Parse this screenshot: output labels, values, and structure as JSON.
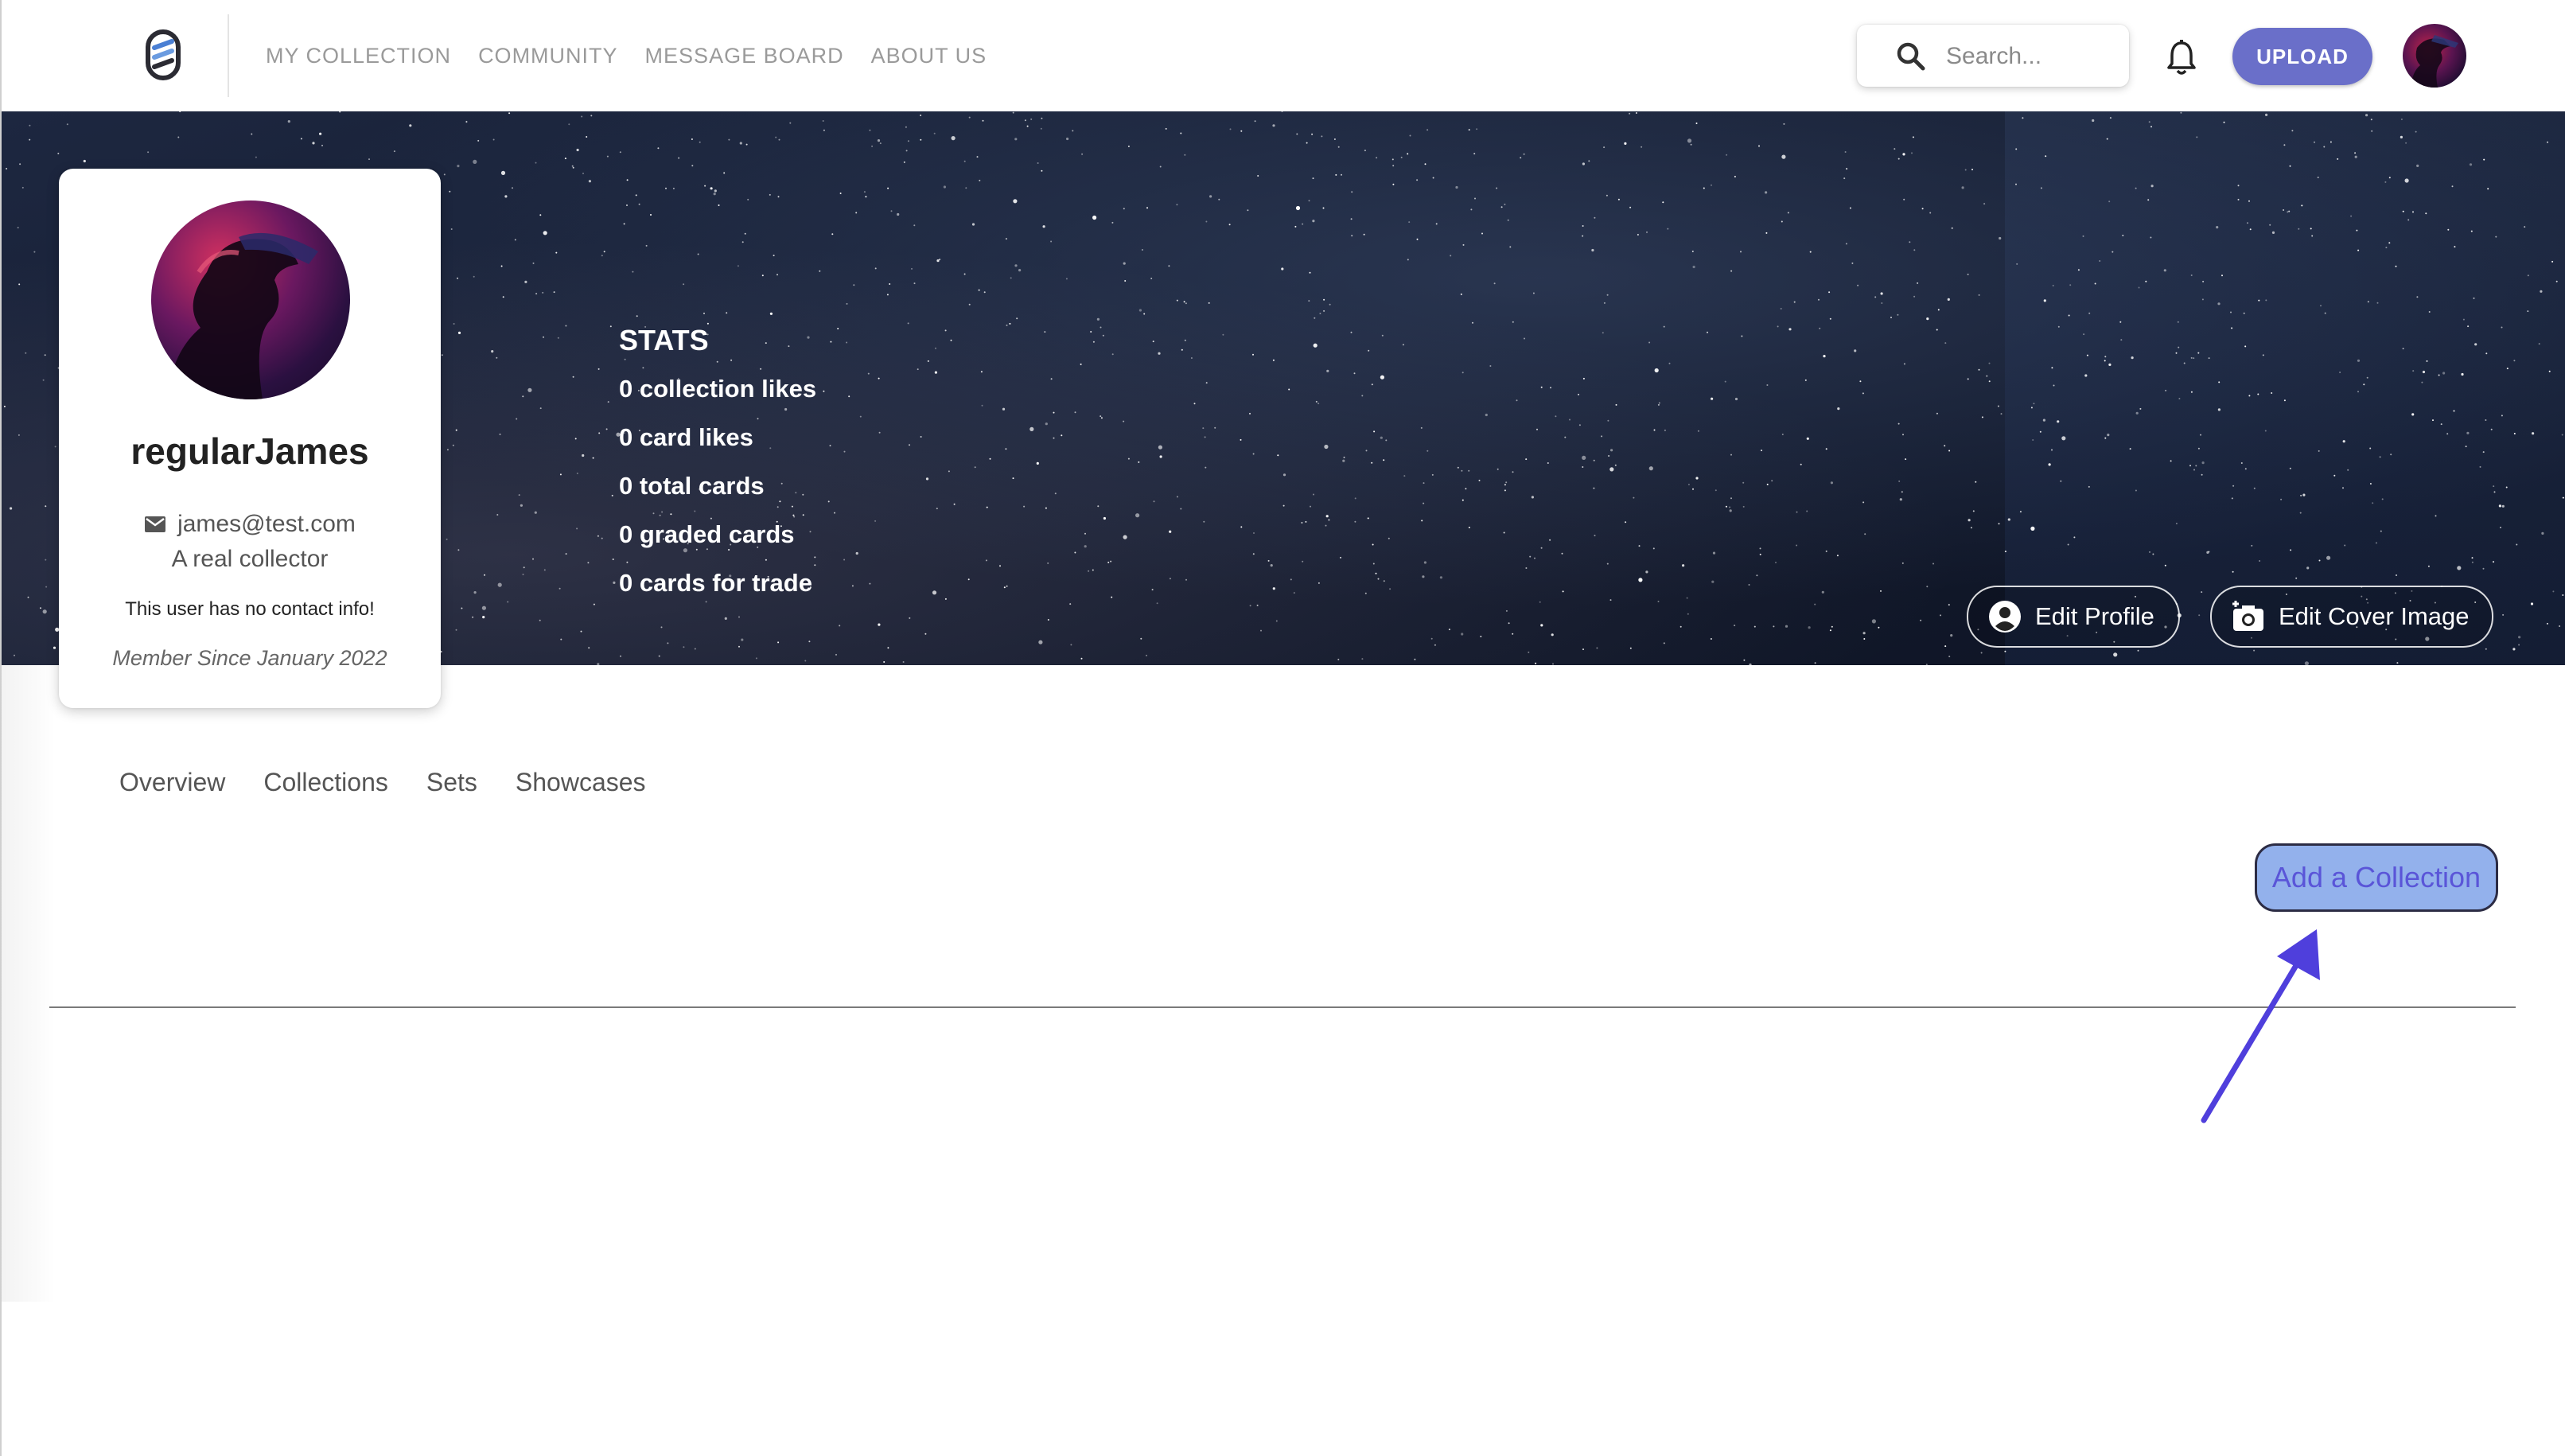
{
  "navbar": {
    "links": [
      "MY COLLECTION",
      "COMMUNITY",
      "MESSAGE BOARD",
      "ABOUT US"
    ],
    "search_placeholder": "Search...",
    "upload_label": "UPLOAD"
  },
  "cover": {
    "stats_title": "STATS",
    "stats": [
      "0 collection likes",
      "0 card likes",
      "0 total cards",
      "0 graded cards",
      "0 cards for trade"
    ],
    "edit_profile_label": "Edit Profile",
    "edit_cover_label": "Edit Cover Image"
  },
  "profile": {
    "username": "regularJames",
    "email": "james@test.com",
    "bio": "A real collector",
    "contact_note": "This user has no contact info!",
    "member_since": "Member Since January 2022"
  },
  "tabs": [
    "Overview",
    "Collections",
    "Sets",
    "Showcases"
  ],
  "main": {
    "add_collection_label": "Add a Collection"
  },
  "colors": {
    "accent": "#6a6fc9",
    "add_button_bg": "#93b1ec",
    "add_button_text": "#5a55d8",
    "arrow": "#4f3fdc"
  }
}
